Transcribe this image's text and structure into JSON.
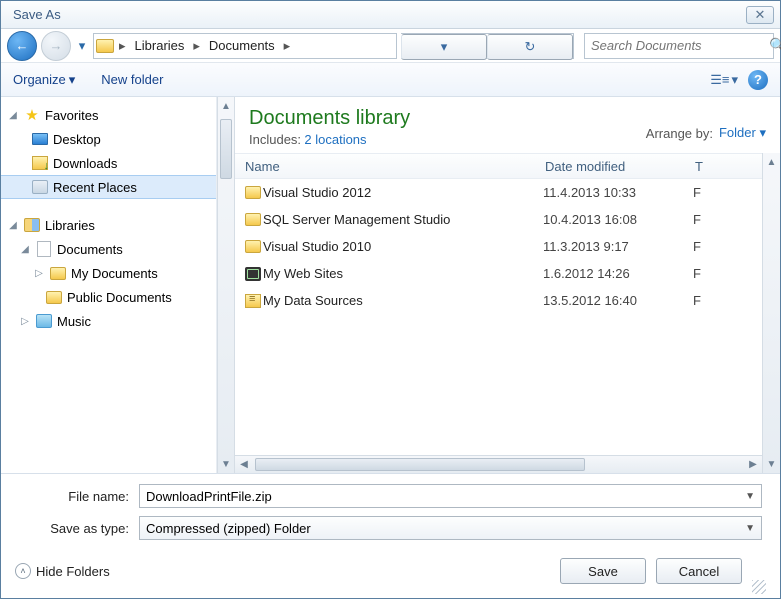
{
  "title": "Save As",
  "breadcrumb": {
    "root_icon": "folder",
    "items": [
      "Libraries",
      "Documents"
    ]
  },
  "search": {
    "placeholder": "Search Documents"
  },
  "toolbar": {
    "organize": "Organize",
    "newfolder": "New folder"
  },
  "tree": {
    "favorites": {
      "label": "Favorites",
      "children": [
        {
          "label": "Desktop",
          "icon": "desktop"
        },
        {
          "label": "Downloads",
          "icon": "downloads"
        },
        {
          "label": "Recent Places",
          "icon": "recent",
          "selected": true
        }
      ]
    },
    "libraries": {
      "label": "Libraries",
      "children": [
        {
          "label": "Documents",
          "icon": "doclib",
          "expanded": true,
          "children": [
            {
              "label": "My Documents",
              "icon": "folder"
            },
            {
              "label": "Public Documents",
              "icon": "folder"
            }
          ]
        },
        {
          "label": "Music",
          "icon": "music"
        }
      ]
    }
  },
  "library_header": {
    "title": "Documents library",
    "includes_label": "Includes:",
    "locations_link": "2 locations",
    "arrange_label": "Arrange by:",
    "arrange_value": "Folder"
  },
  "columns": {
    "name": "Name",
    "date": "Date modified",
    "type": "T"
  },
  "rows": [
    {
      "name": "Visual Studio 2012",
      "date": "11.4.2013 10:33",
      "type": "F",
      "icon": "folder"
    },
    {
      "name": "SQL Server Management Studio",
      "date": "10.4.2013 16:08",
      "type": "F",
      "icon": "folder"
    },
    {
      "name": "Visual Studio 2010",
      "date": "11.3.2013 9:17",
      "type": "F",
      "icon": "folder"
    },
    {
      "name": "My Web Sites",
      "date": "1.6.2012 14:26",
      "type": "F",
      "icon": "web"
    },
    {
      "name": "My Data Sources",
      "date": "13.5.2012 16:40",
      "type": "F",
      "icon": "data"
    }
  ],
  "form": {
    "filename_label": "File name:",
    "filename_value": "DownloadPrintFile.zip",
    "saveastype_label": "Save as type:",
    "saveastype_value": "Compressed (zipped) Folder"
  },
  "footer": {
    "hidefolders": "Hide Folders",
    "save": "Save",
    "cancel": "Cancel"
  }
}
